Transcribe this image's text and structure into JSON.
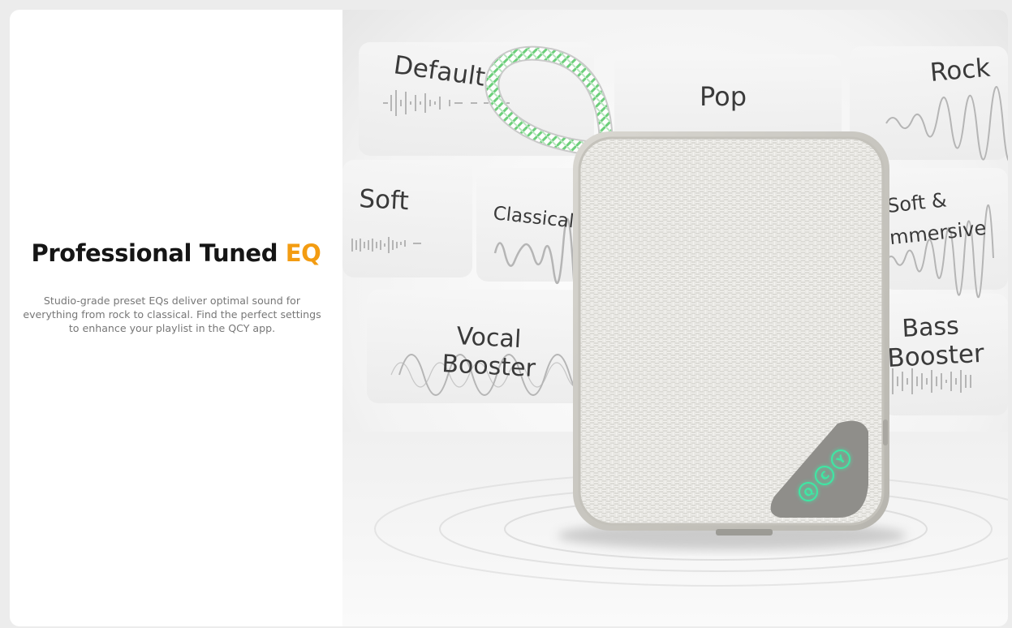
{
  "headline": {
    "main": "Professional Tuned ",
    "accent": "EQ",
    "accent_color": "#f39c12"
  },
  "description": "Studio-grade preset EQs deliver optimal sound for everything from rock to classical. Find the perfect settings to enhance your playlist in the QCY app.",
  "eq_presets": {
    "default": "Default",
    "pop": "Pop",
    "rock": "Rock",
    "soft": "Soft",
    "classical": "Classical",
    "soft_immersive_line1": "Soft &",
    "soft_immersive_line2": "Immersive",
    "vocal_line1": "Vocal",
    "vocal_line2": "Booster",
    "bass_line1": "Bass",
    "bass_line2": "Booster"
  },
  "device": {
    "logo_letters": [
      "Q",
      "C",
      "Y"
    ],
    "logo_glow_color": "#3ee8a4",
    "strap_accent_color": "#6ccf7a"
  }
}
